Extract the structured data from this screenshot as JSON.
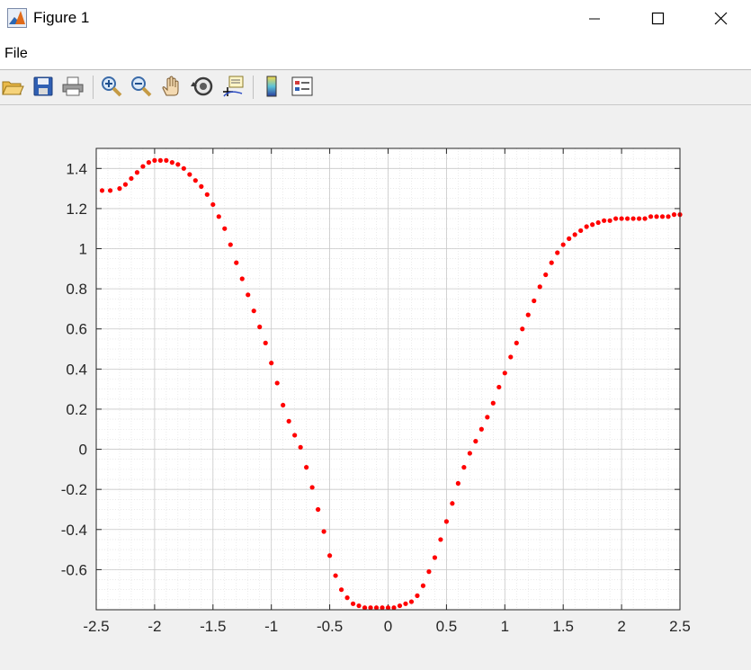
{
  "window": {
    "title": "Figure 1",
    "app_icon": "matlab-icon"
  },
  "window_controls": {
    "minimize": "minimize-icon",
    "maximize": "maximize-icon",
    "close": "close-icon"
  },
  "menu": {
    "items": [
      {
        "label": "File"
      }
    ]
  },
  "toolbar": {
    "buttons": [
      {
        "icon": "open-folder-icon"
      },
      {
        "icon": "save-icon"
      },
      {
        "icon": "print-icon"
      },
      {
        "icon": "zoom-in-icon"
      },
      {
        "icon": "zoom-out-icon"
      },
      {
        "icon": "pan-hand-icon"
      },
      {
        "icon": "rotate-3d-icon"
      },
      {
        "icon": "data-cursor-icon"
      },
      {
        "icon": "colorbar-icon"
      },
      {
        "icon": "legend-icon"
      }
    ]
  },
  "colors": {
    "series": "#ff0000",
    "axes": "#262626",
    "grid": "#c8c8c8",
    "plot_bg": "#ffffff",
    "figure_bg": "#f0f0f0"
  },
  "chart_data": {
    "type": "scatter",
    "title": "",
    "xlabel": "",
    "ylabel": "",
    "xlim": [
      -2.5,
      2.5
    ],
    "ylim": [
      -0.8,
      1.5
    ],
    "grid": "major and minor",
    "x_ticks": [
      "-2.5",
      "-2",
      "-1.5",
      "-1",
      "-0.5",
      "0",
      "0.5",
      "1",
      "1.5",
      "2",
      "2.5"
    ],
    "y_ticks": [
      "1.4",
      "1.2",
      "1",
      "0.8",
      "0.6",
      "0.4",
      "0.2",
      "0",
      "-0.2",
      "-0.4",
      "-0.6"
    ],
    "series": [
      {
        "marker": "filled-dot",
        "color": "#ff0000",
        "x": [
          -2.45,
          -2.38,
          -2.3,
          -2.25,
          -2.2,
          -2.15,
          -2.1,
          -2.05,
          -2.0,
          -1.95,
          -1.9,
          -1.85,
          -1.8,
          -1.75,
          -1.7,
          -1.65,
          -1.6,
          -1.55,
          -1.5,
          -1.45,
          -1.4,
          -1.35,
          -1.3,
          -1.25,
          -1.2,
          -1.15,
          -1.1,
          -1.05,
          -1.0,
          -0.95,
          -0.9,
          -0.85,
          -0.8,
          -0.75,
          -0.7,
          -0.65,
          -0.6,
          -0.55,
          -0.5,
          -0.45,
          -0.4,
          -0.35,
          -0.3,
          -0.25,
          -0.2,
          -0.15,
          -0.1,
          -0.05,
          0.0,
          0.05,
          0.1,
          0.15,
          0.2,
          0.25,
          0.3,
          0.35,
          0.4,
          0.45,
          0.5,
          0.55,
          0.6,
          0.65,
          0.7,
          0.75,
          0.8,
          0.85,
          0.9,
          0.95,
          1.0,
          1.05,
          1.1,
          1.15,
          1.2,
          1.25,
          1.3,
          1.35,
          1.4,
          1.45,
          1.5,
          1.55,
          1.6,
          1.65,
          1.7,
          1.75,
          1.8,
          1.85,
          1.9,
          1.95,
          2.0,
          2.05,
          2.1,
          2.15,
          2.2,
          2.25,
          2.3,
          2.35,
          2.4,
          2.45,
          2.5
        ],
        "y": [
          1.29,
          1.29,
          1.3,
          1.32,
          1.35,
          1.38,
          1.41,
          1.43,
          1.44,
          1.44,
          1.44,
          1.43,
          1.42,
          1.4,
          1.37,
          1.34,
          1.31,
          1.27,
          1.22,
          1.16,
          1.1,
          1.02,
          0.93,
          0.85,
          0.77,
          0.69,
          0.61,
          0.53,
          0.43,
          0.33,
          0.22,
          0.14,
          0.07,
          0.01,
          -0.09,
          -0.19,
          -0.3,
          -0.41,
          -0.53,
          -0.63,
          -0.7,
          -0.74,
          -0.77,
          -0.78,
          -0.79,
          -0.79,
          -0.79,
          -0.79,
          -0.79,
          -0.79,
          -0.78,
          -0.77,
          -0.76,
          -0.73,
          -0.68,
          -0.61,
          -0.54,
          -0.45,
          -0.36,
          -0.27,
          -0.17,
          -0.09,
          -0.02,
          0.04,
          0.1,
          0.16,
          0.23,
          0.31,
          0.38,
          0.46,
          0.53,
          0.6,
          0.67,
          0.74,
          0.81,
          0.87,
          0.93,
          0.98,
          1.02,
          1.05,
          1.07,
          1.09,
          1.11,
          1.12,
          1.13,
          1.14,
          1.14,
          1.15,
          1.15,
          1.15,
          1.15,
          1.15,
          1.15,
          1.16,
          1.16,
          1.16,
          1.16,
          1.17,
          1.17
        ]
      }
    ]
  }
}
